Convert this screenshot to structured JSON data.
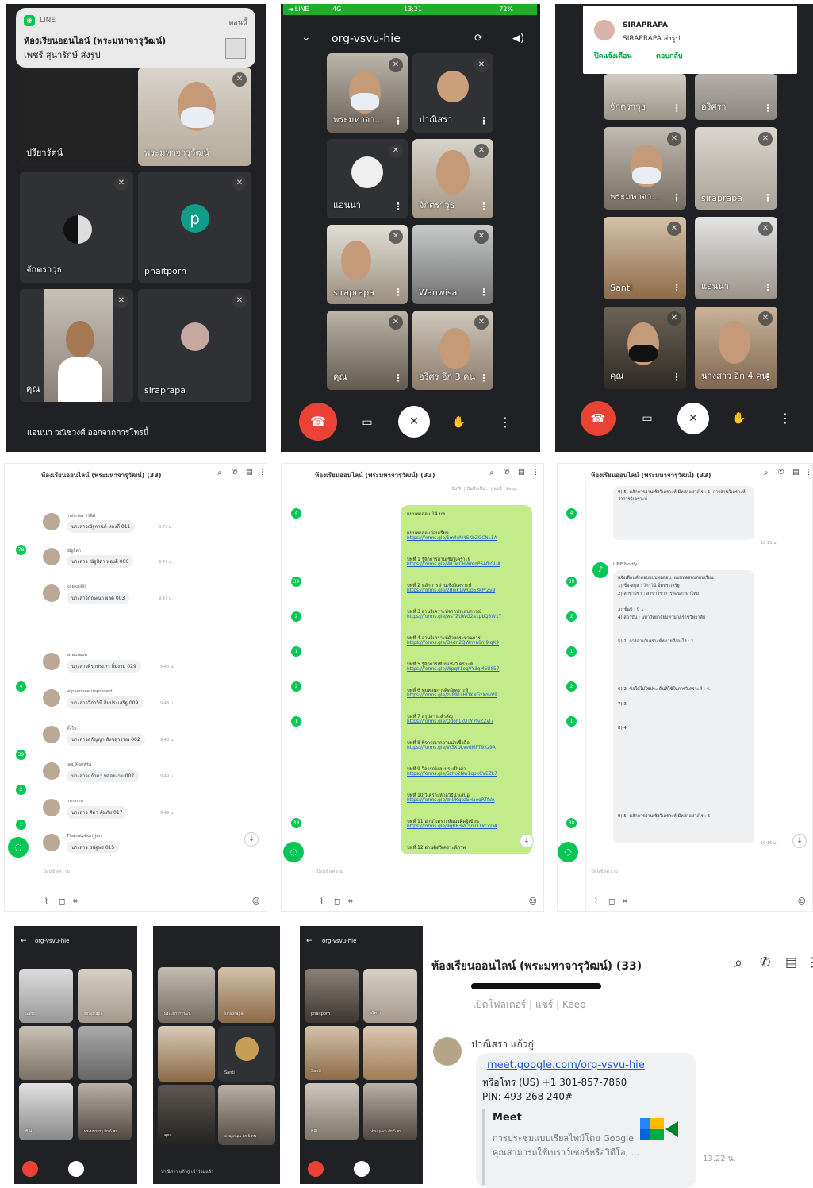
{
  "p1": {
    "notif_app": "LINE",
    "notif_time": "ตอนนี้",
    "notif_title": "ห้องเรียนออนไลน์ (พระมหาจารุวัฒน์)",
    "notif_body": "เพชรี สุนารักษ์ ส่งรูป",
    "tiles": [
      "ปรียารัตน์",
      "พระมหาจารุวัฒน์",
      "จักตราวุธ",
      "phaitporn",
      "คุณ",
      "siraprapa"
    ],
    "avatar_letter": "p",
    "footer": "แอนนา วณิชวงศ์ ออกจากการโทรนี้"
  },
  "p2": {
    "status_left": "◄ LINE",
    "status_net": "4G",
    "status_time": "13:21",
    "status_batt": "72%",
    "meeting_code": "org-vsvu-hie",
    "tiles": [
      "พระมหาจา...",
      "ปาณิสรา",
      "แอนนา",
      "จักตราวุธ",
      "siraprapa",
      "Wanwisa",
      "คุณ",
      "อริศร  อีก 3 คน"
    ]
  },
  "p3": {
    "notif_name": "SIRAPRAPA",
    "notif_body": "SIRAPRAPA ส่งรูป",
    "notif_action1": "ปิดแจ้งเตือน",
    "notif_action2": "ตอบกลับ",
    "tiles": [
      "จักตราวุธ",
      "อริศรา",
      "พระมหาจา...",
      "siraprapa",
      "Santi",
      "แอนนา",
      "คุณ",
      "นางสาว  อีก 4 คน"
    ]
  },
  "chat_title": "ห้องเรียนออนไลน์ (พระมหาจารุวัฒน์) (33)",
  "chat_input_placeholder": "ป้อนข้อความ",
  "c1": {
    "messages": [
      {
        "name": "nuttrisa วรพิศ",
        "text": "นางสาวณัฐกานต์ ทองดี 011",
        "time": "9.47 น."
      },
      {
        "name": "ณัฐธิดา",
        "text": "นางสาว ณัฐธิดา ทองดี 006",
        "time": "9.47 น."
      },
      {
        "name": "kaekaiiiii",
        "text": "นางสาวกฤษณา ผลดี 003",
        "time": "9.47 น."
      },
      {
        "name": "siraprapa",
        "text": "นางสาวศิราประภา ยิ้มงาม 029",
        "time": "9.48 น."
      },
      {
        "name": "wipawinee imprasert",
        "text": "นางสาววิภาวินี อิ่มประเสริฐ 009",
        "time": "9.48 น."
      },
      {
        "name": "ตั้งใจ",
        "text": "นางสาวสุกัญญา สังขสุวรรณ 002",
        "time": "9.48 น."
      },
      {
        "name": "Jaa_Kaewta",
        "text": "นางสาวแก้วตา พลอยงาม 007",
        "time": "9.49 น."
      },
      {
        "name": "mmmm",
        "text": "นางสาว ศิตา คุ้มภัย 017",
        "time": "9.49 น."
      },
      {
        "name": "Thanatphon_jen",
        "text": "นางสาว ธนัฐพร 015",
        "time": ""
      }
    ],
    "badges": [
      "78",
      "4",
      "39",
      "2",
      "1"
    ]
  },
  "c2": {
    "top_note": "บันทึก | บันทึกเป็น... | แชร์ | Keep",
    "header": "แบบทดสอบ 14 บท",
    "items": [
      {
        "t": "แบบทดสอบก่อนเรียน",
        "u": "https://forms.gle/1m4sM4SKbZGCNL1A"
      },
      {
        "t": "บทที่ 1 รู้จักการอ่านเชิงวิเคราะห์",
        "u": "https://forms.gle/WLTwCHWmqP6AfkGUA"
      },
      {
        "t": "บทที่ 2 หลักการอ่านเชิงวิเคราะห์",
        "u": "https://forms.gle/2Bwk1iwUp53kPrZv9"
      },
      {
        "t": "บทที่ 3 อ่านวิเคราะห์จากประสบการณ์",
        "u": "https://forms.gle/wsYZUWG2a1pbQ8W17"
      },
      {
        "t": "บทที่ 4 อ่านวิเคราะห์ด้วยกระบวนการ",
        "u": "https://forms.gle/Dedn2QWnya6m9jgX9"
      },
      {
        "t": "บทที่ 5 รู้จักการเขียนเชิงวิเคราะห์",
        "u": "https://forms.gle/Wpq81oqVY3qM6U857"
      },
      {
        "t": "บทที่ 6 ทบทวนการคิดวิเคราะห์",
        "u": "https://forms.gle/zv891sHDXNGzXdvV9"
      },
      {
        "t": "บทที่ 7 สรุปสาระสำคัญ",
        "u": "https://forms.gle/QdonLkUTY7fvZZyJ7"
      },
      {
        "t": "บทที่ 8 พิจารณาความน่าเชื่อถือ",
        "u": "https://forms.gle/Vf3XULvvdMFT9Xz9A"
      },
      {
        "t": "บทที่ 9 วิจารณ์และประเมินค่า",
        "u": "https://forms.gle/Szho2Nw1qpkCVEZk7"
      },
      {
        "t": "บทที่ 10 วิเคราะห์กลวิธีนำเสนอ",
        "u": "https://forms.gle/znUKgezEHaeqRTfVA"
      },
      {
        "t": "บทที่ 11 อ่านวิเคราะห์แนวคิดผู้เขียน",
        "u": "https://forms.gle/9gRR3VC5nTTFkCcQA"
      },
      {
        "t": "บทที่ 12 อ่านคิดวิเคราะห์ภาพ",
        "u": ""
      }
    ],
    "badges": [
      "4",
      "39",
      "2",
      "1",
      "2",
      "1",
      "38"
    ]
  },
  "c3": {
    "top_text": "9) 5. หลักการอ่านเชิงวิเคราะห์ มีหลักอย่างไร : 5. การอ่านวิเคราะห์ว่าการวิเคราะห์ ...",
    "notify_name": "LINE Notify",
    "notify_lines": [
      "แจ้งเตือนคำตอบแบบทดสอบ: แบบทดสอบก่อนเรียน",
      "1) ชื่อ-สกุล : วีภาวินี อิ่มประเสริฐ",
      "2) สาขาวิชา : สาขาวิชาการสอนภาษาไทย",
      "3) ชั้นปี : ปี 1",
      "4) สถาบัน : มหาวิทยาลัยมหามกุฏราชวิทยาลัย",
      "5) 1. การอ่านวิเคราะห์หมายถึงอะไร : 1.",
      "6) 2. ข้อใดไม่ใช่ประเด็นที่ใช้ในการวิเคราะห์ : 4.",
      "7) 3.",
      "8) 4.",
      "9) 5. หลักการอ่านเชิงวิเคราะห์ มีหลักอย่างไร : 5."
    ],
    "badges": [
      "4",
      "39",
      "2",
      "1",
      "2",
      "1",
      "38"
    ],
    "time1": "10.13 น.",
    "time2": "10.16 น."
  },
  "p4": {
    "meeting_code": "org-vsvu-hie",
    "tiles": [
      "Santi",
      "siraprapa",
      "",
      "",
      "คุณ",
      "พระมหาจารุ  อีก 6 คน"
    ]
  },
  "p5": {
    "tiles": [
      "พระมหาจารุวัฒน์",
      "siraprapa",
      "",
      "Santi",
      "คุณ",
      "siraprapa  อีก 5 คน"
    ],
    "footer": "ปาณิสรา แก้วกู่ เข้าร่วมแล้ว"
  },
  "p6": {
    "meeting_code": "org-vsvu-hie",
    "tiles": [
      "phaitporn",
      "อริศรา",
      "Santi",
      "",
      "คุณ",
      "phaitporn  อีก 5 คน"
    ]
  },
  "big": {
    "title": "ห้องเรียนออนไลน์ (พระมหาจารุวัฒน์) (33)",
    "note": "เปิดโฟลเดอร์ | แชร์ | Keep",
    "sender": "ปาณิสรา แก้วกู่",
    "link": "meet.google.com/org-vsvu-hie",
    "phone": "หรือโทร (US) +1 301-857-7860",
    "pin": "PIN: 493 268 240#",
    "card_title": "Meet",
    "card_line1": "การประชุมแบบเรียลไทม์โดย Google",
    "card_line2": "คุณสามารถใช้เบราว์เซอร์หรือวิดีโอ, ...",
    "time": "13.22 น.",
    "meet_colors": [
      "#00832d",
      "#0066da",
      "#e94235",
      "#2684fc",
      "#00ac47",
      "#ffba00"
    ]
  }
}
